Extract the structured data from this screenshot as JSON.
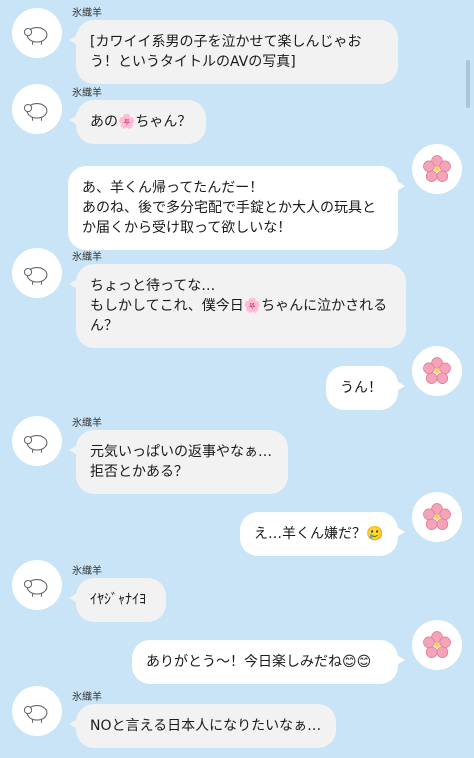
{
  "sender_name": "氷織羊",
  "messages": [
    {
      "side": "left",
      "text": "[カワイイ系男の子を泣かせて楽しんじゃおう！というタイトルのAVの写真]"
    },
    {
      "side": "left",
      "text": "あの🌸ちゃん？"
    },
    {
      "side": "right",
      "text": "あ、羊くん帰ってたんだー！\nあのね、後で多分宅配で手錠とか大人の玩具とか届くから受け取って欲しいな！"
    },
    {
      "side": "left",
      "text": "ちょっと待ってな…\nもしかしてこれ、僕今日🌸ちゃんに泣かされるん？"
    },
    {
      "side": "right",
      "text": "うん！"
    },
    {
      "side": "left",
      "text": "元気いっぱいの返事やなぁ…\n拒否とかある？"
    },
    {
      "side": "right",
      "text": "え…羊くん嫌だ？🥲"
    },
    {
      "side": "left",
      "text": "ｲﾔｼﾞｬﾅｲﾖ"
    },
    {
      "side": "right",
      "text": "ありがとう〜！今日楽しみだね😊😊"
    },
    {
      "side": "left",
      "text": "NOと言える日本人になりたいなぁ…"
    }
  ]
}
